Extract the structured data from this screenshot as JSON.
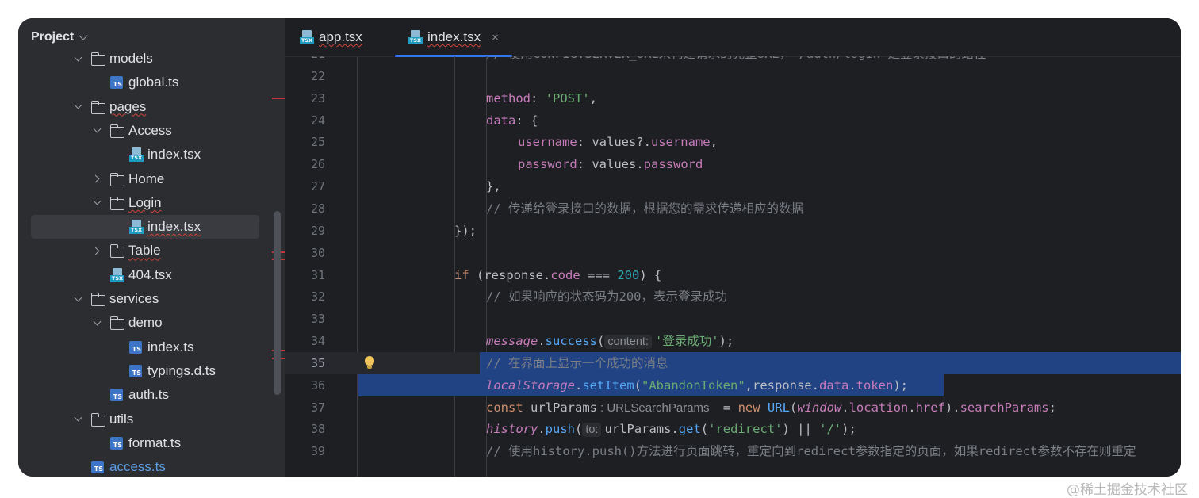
{
  "sidebar": {
    "title": "Project",
    "items": [
      {
        "label": "models",
        "type": "folder",
        "level": 3,
        "arrow": "down"
      },
      {
        "label": "global.ts",
        "type": "ts",
        "level": 4
      },
      {
        "label": "pages",
        "type": "folder",
        "level": 3,
        "arrow": "down",
        "squiggle": true
      },
      {
        "label": "Access",
        "type": "folder",
        "level": 4,
        "arrow": "down"
      },
      {
        "label": "index.tsx",
        "type": "tsx",
        "level": 5
      },
      {
        "label": "Home",
        "type": "folder",
        "level": 4,
        "arrow": "right"
      },
      {
        "label": "Login",
        "type": "folder",
        "level": 4,
        "arrow": "down",
        "squiggle": true
      },
      {
        "label": "index.tsx",
        "type": "tsx",
        "level": 5,
        "selected": true,
        "squiggle": true
      },
      {
        "label": "Table",
        "type": "folder",
        "level": 4,
        "arrow": "right",
        "squiggle": true
      },
      {
        "label": "404.tsx",
        "type": "tsx",
        "level": 4
      },
      {
        "label": "services",
        "type": "folder",
        "level": 3,
        "arrow": "down"
      },
      {
        "label": "demo",
        "type": "folder",
        "level": 4,
        "arrow": "down"
      },
      {
        "label": "index.ts",
        "type": "ts",
        "level": 5
      },
      {
        "label": "typings.d.ts",
        "type": "ts",
        "level": 5
      },
      {
        "label": "auth.ts",
        "type": "ts",
        "level": 4
      },
      {
        "label": "utils",
        "type": "folder",
        "level": 3,
        "arrow": "down"
      },
      {
        "label": "format.ts",
        "type": "ts",
        "level": 4
      },
      {
        "label": "access.ts",
        "type": "ts",
        "level": 3,
        "blue": true
      }
    ]
  },
  "tabs": [
    {
      "label": "app.tsx",
      "active": false
    },
    {
      "label": "index.tsx",
      "active": true,
      "close": "×"
    }
  ],
  "editor": {
    "current_line": 35,
    "lines": [
      {
        "n": "21",
        "indent": 1,
        "tokens": [
          [
            "c-com",
            "// 使用CONFIG.SERVER_URL来构建请求的完整URL，'/auth/login'是登录接口的路径"
          ]
        ]
      },
      {
        "n": "22",
        "indent": 0,
        "tokens": []
      },
      {
        "n": "23",
        "indent": 1,
        "tokens": [
          [
            "c-prop",
            "method"
          ],
          [
            "",
            ": "
          ],
          [
            "c-str",
            "'POST'"
          ],
          [
            "",
            ","
          ]
        ]
      },
      {
        "n": "24",
        "indent": 1,
        "tokens": [
          [
            "c-prop",
            "data"
          ],
          [
            "",
            ": {"
          ]
        ]
      },
      {
        "n": "25",
        "indent": 2,
        "tokens": [
          [
            "c-prop",
            "username"
          ],
          [
            "",
            ": values?."
          ],
          [
            "c-prop",
            "username"
          ],
          [
            "",
            ","
          ]
        ]
      },
      {
        "n": "26",
        "indent": 2,
        "tokens": [
          [
            "c-prop",
            "password"
          ],
          [
            "",
            ": values."
          ],
          [
            "c-prop",
            "password"
          ]
        ]
      },
      {
        "n": "27",
        "indent": 1,
        "tokens": [
          [
            "",
            "},"
          ]
        ]
      },
      {
        "n": "28",
        "indent": 1,
        "tokens": [
          [
            "c-com",
            "// 传递给登录接口的数据，根据您的需求传递相应的数据"
          ]
        ]
      },
      {
        "n": "29",
        "indent": 0,
        "tokens": [
          [
            "",
            "});"
          ]
        ]
      },
      {
        "n": "30",
        "indent": 0,
        "tokens": []
      },
      {
        "n": "31",
        "indent": 0,
        "tokens": [
          [
            "c-kw",
            "if"
          ],
          [
            "",
            " (response."
          ],
          [
            "c-prop",
            "code"
          ],
          [
            "",
            " === "
          ],
          [
            "c-num",
            "200"
          ],
          [
            "",
            ") {"
          ]
        ]
      },
      {
        "n": "32",
        "indent": 1,
        "tokens": [
          [
            "c-com",
            "// 如果响应的状态码为200，表示登录成功"
          ]
        ]
      },
      {
        "n": "33",
        "indent": 0,
        "tokens": []
      },
      {
        "n": "34",
        "indent": 1,
        "tokens": [
          [
            "c-glob",
            "message"
          ],
          [
            "",
            "."
          ],
          [
            "c-fn",
            "success"
          ],
          [
            "",
            "("
          ],
          [
            "c-hint",
            "content:"
          ],
          [
            "c-str",
            "'登录成功'"
          ],
          [
            "",
            ");"
          ]
        ]
      },
      {
        "n": "35",
        "indent": 1,
        "tokens": [
          [
            "c-com",
            "// 在界面上显示一个成功的消息"
          ]
        ]
      },
      {
        "n": "36",
        "indent": 1,
        "tokens": [
          [
            "c-glob",
            "localStorage"
          ],
          [
            "",
            "."
          ],
          [
            "c-fn",
            "setItem"
          ],
          [
            "",
            "("
          ],
          [
            "c-str",
            "\"AbandonToken\""
          ],
          [
            "",
            ",response."
          ],
          [
            "c-prop",
            "data"
          ],
          [
            "",
            "."
          ],
          [
            "c-prop",
            "token"
          ],
          [
            "",
            ");"
          ]
        ]
      },
      {
        "n": "37",
        "indent": 1,
        "tokens": [
          [
            "c-kw",
            "const"
          ],
          [
            "",
            " urlParams"
          ],
          [
            "c-type",
            ": URLSearchParams"
          ],
          [
            "",
            " = "
          ],
          [
            "c-kw",
            "new"
          ],
          [
            "",
            " "
          ],
          [
            "c-cls",
            "URL"
          ],
          [
            "",
            "("
          ],
          [
            "c-glob",
            "window"
          ],
          [
            "",
            "."
          ],
          [
            "c-prop",
            "location"
          ],
          [
            "",
            "."
          ],
          [
            "c-prop",
            "href"
          ],
          [
            "",
            ")."
          ],
          [
            "c-prop",
            "searchParams"
          ],
          [
            "",
            ";"
          ]
        ]
      },
      {
        "n": "38",
        "indent": 1,
        "tokens": [
          [
            "c-glob",
            "history"
          ],
          [
            "",
            "."
          ],
          [
            "c-fn",
            "push"
          ],
          [
            "",
            "("
          ],
          [
            "c-hint",
            "to:"
          ],
          [
            "",
            "urlParams."
          ],
          [
            "c-fn",
            "get"
          ],
          [
            "",
            "("
          ],
          [
            "c-str",
            "'redirect'"
          ],
          [
            "",
            ") || "
          ],
          [
            "c-str",
            "'/'"
          ],
          [
            "",
            ");"
          ]
        ]
      },
      {
        "n": "39",
        "indent": 1,
        "tokens": [
          [
            "c-com",
            "// 使用history.push()方法进行页面跳转，重定向到redirect参数指定的页面，如果redirect参数不存在则重定"
          ]
        ]
      }
    ]
  },
  "watermark": "@稀土掘金技术社区"
}
